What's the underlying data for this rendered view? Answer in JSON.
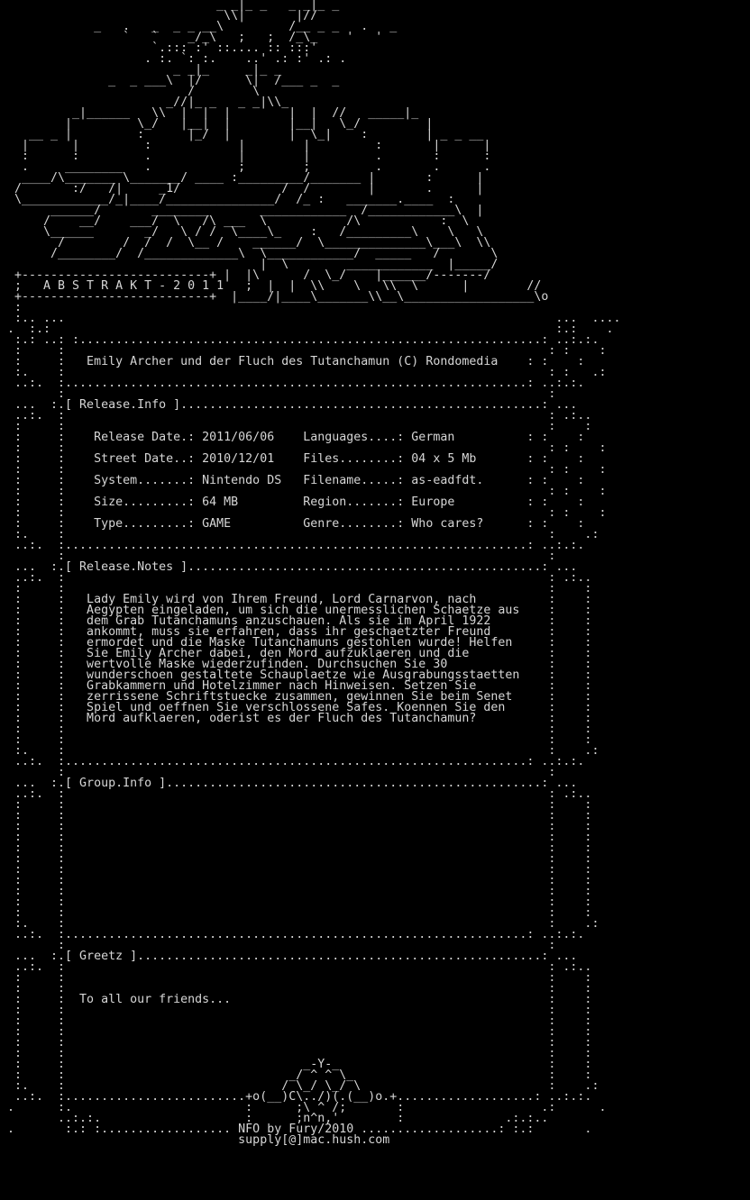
{
  "nfo": {
    "lines": [
      "                             _ _|_ _   _ _|_ _",
      "                              \\\\|       |//",
      "            _   .   _  _ _ __\\         /__ _ _   .   _",
      "                `   `    _/_\\   ;   ;  /_\\_    '   '",
      "                    `.::: :' ::.... :: :::'",
      "                   . :. `: :.    ..' .: :' .: .",
      "                       _ _|_     _|_ _",
      "              _  _ ___\\  |/      \\|  /___ _  _",
      "                         /        \\",
      "                      _//|_ _   _ _|\\\\_",
      "         _|______   \\\\  |  |  |        |  |  //   _____|_",
      "        |         \\_/   |__|  |        |__|   \\_/         |",
      "   __ _ |         :      |_/  |        |  \\_|    :        | _ _ __",
      "  |      |         :            |        |         :       |      |",
      "  :      :         .            |        |         .       :      :",
      "  .     ________   .            ;        ;         .       .      .",
      "  ____/\\_______ \\_______/ ____ :_________/_______ |       :      |",
      " /       :/   /|     _1/              /  /        |       .      |",
      " \\____________/_|____/_______________/  /_ :   _______.____  :",
      "      ______/       ________       ____________  /____________\\  |",
      "     /    __/    ___/  \\   /\\ ___  \\           /\\           :  \\",
      "     \\______       _/   \\ / /  \\____\\_    :   /_________\\    \\   \\",
      "       /        /  /  /  \\__ /    ______/  \\______________\\___\\  \\\\",
      "      /________/  /_____________\\  \\____________/  _____   /       \\",
      "                                   |  \\        ____________  |_____/",
      " +--------------------------+ |  |\\      /  \\_/    |______/-------/",
      " ;   A B S T R A K T - 2 0 1 1   ;  |  |  \\\\    \\   \\\\  \\      |        //",
      " +--------------------------+  |____/|____\\_______\\\\__\\__________________\\o",
      " :",
      " :.. ...                                                                    ...  ....",
      ".  :.:                                                                      :.:    .",
      " :.: ..: :................................................................: ..:.:.",
      " :     :                                                                   : :    :",
      " :     :   Emily Archer und der Fluch des Tutanchamun (C) Rondomedia    : :    :",
      " :.    :                                                                   : :   .:",
      " ..:.  :................................................................: ..:.:.",
      "       :                                                                   :",
      " ...  :.[ Release.Info ]..................................................: ...",
      " ..:.  :                                                                   : .:..",
      " :     :                                                                   :    :",
      " :     :    Release Date.: 2011/06/06    Languages....: German          : :    :",
      " :     :                                                                   : :    :",
      " :     :    Street Date..: 2010/12/01    Files........: 04 x 5 Mb       : :    :",
      " :     :                                                                   : :    :",
      " :     :    System.......: Nintendo DS   Filename.....: as-eadfdt.      : :    :",
      " :     :                                                                   : :    :",
      " :     :    Size.........: 64 MB         Region.......: Europe          : :    :",
      " :     :                                                                   : :    :",
      " :     :    Type.........: GAME          Genre........: Who cares?      : :    :",
      " :.    :                                                                   :    .:",
      " ..:.  :................................................................: ..:.:.",
      "       :                                                                   :",
      " ...  :.[ Release.Notes ].................................................: ...",
      " ..:.  :                                                                   : .:..",
      " :     :                                                                   :    :",
      " :     :   Lady Emily wird von Ihrem Freund, Lord Carnarvon, nach          :    :",
      " :     :   Aegypten eingeladen, um sich die unermesslichen Schaetze aus    :    :",
      " :     :   dem Grab Tutanchamuns anzuschauen. Als sie im April 1922        :    :",
      " :     :   ankommt, muss sie erfahren, dass ihr geschaetzter Freund        :    :",
      " :     :   ermordet und die Maske Tutanchamuns gestohlen wurde! Helfen     :    :",
      " :     :   Sie Emily Archer dabei, den Mord aufzuklaeren und die           :    :",
      " :     :   wertvolle Maske wiederzufinden. Durchsuchen Sie 30              :    :",
      " :     :   wunderschoen gestaltete Schauplaetze wie Ausgrabungsstaetten    :    :",
      " :     :   Grabkammern und Hotelzimmer nach Hinweisen. Setzen Sie          :    :",
      " :     :   zerrissene Schriftstuecke zusammen, gewinnen Sie beim Senet     :    :",
      " :     :   Spiel und oeffnen Sie verschlossene Safes. Koennen Sie den      :    :",
      " :     :   Mord aufklaeren, oderist es der Fluch des Tutanchamun?          :    :",
      " :     :                                                                   :    :",
      " :     :                                                                   :    :",
      " :.    :                                                                   :    .:",
      " ..:.  :................................................................: ..:.:.",
      "       :                                                                   :",
      " ...  :.[ Group.Info ]....................................................: ...",
      " ..:.  :                                                                   : .:..",
      " :     :                                                                   :    :",
      " :     :                                                                   :    :",
      " :     :                                                                   :    :",
      " :     :                                                                   :    :",
      " :     :                                                                   :    :",
      " :     :                                                                   :    :",
      " :     :                                                                   :    :",
      " :     :                                                                   :    :",
      " :     :                                                                   :    :",
      " :     :                                                                   :    :",
      " :     :                                                                   :    :",
      " :.    :                                                                   :    .:",
      " ..:.  :................................................................: ..:.:.",
      "       :                                                                   :",
      " ...  :.[ Greetz ]........................................................: ...",
      " ..:.  :                                                                   : .:..",
      " :     :                                                                   :    :",
      " :     :                                                                   :    :",
      " :     :  To all our friends...                                            :    :",
      " :     :                                                                   :    :",
      " :     :                                                                   :    :",
      " :     :                                                                   :    :",
      " :     :                                                                   :    :",
      " :     :                                                                   :    :",
      " :     :                                 _-Y-_                             :    :",
      " :     :                               _/ ^ ^ \\_                           :    :",
      " :.    :                              / \\_/ \\_/ \\                          :    .:",
      " ..:.  :.........................+o(__)C\\../)(.(__)o.+...................: ..:.:.",
      ".      :.                        :      ;\\ ^ /;       :                   .:      .",
      "       ..:.:.                    :      ;n^n,'        :              .:.:..",
      ".       :.: :.................. NFO by Fury/2010 ...................: :.:       .",
      "                                supply[@]mac.hush.com"
    ]
  }
}
